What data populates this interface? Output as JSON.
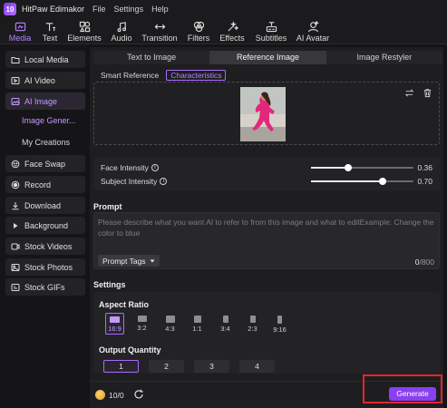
{
  "app": {
    "name": "HitPaw Edimakor",
    "logo_text": "10",
    "menu": [
      "File",
      "Settings",
      "Help"
    ]
  },
  "toolbar": {
    "items": [
      {
        "label": "Media",
        "icon": "media-icon",
        "active": true
      },
      {
        "label": "Text",
        "icon": "text-icon"
      },
      {
        "label": "Elements",
        "icon": "elements-icon"
      },
      {
        "label": "Audio",
        "icon": "audio-icon"
      },
      {
        "label": "Transition",
        "icon": "transition-icon"
      },
      {
        "label": "Filters",
        "icon": "filters-icon"
      },
      {
        "label": "Effects",
        "icon": "effects-icon"
      },
      {
        "label": "Subtitles",
        "icon": "subtitles-icon"
      },
      {
        "label": "AI Avatar",
        "icon": "ai-avatar-icon"
      }
    ]
  },
  "sidebar": {
    "items": [
      {
        "label": "Local Media",
        "icon": "folder-icon"
      },
      {
        "label": "AI Video",
        "icon": "ai-video-icon"
      },
      {
        "label": "AI Image",
        "icon": "ai-image-icon",
        "active": true
      },
      {
        "label": "Face Swap",
        "icon": "face-swap-icon"
      },
      {
        "label": "Record",
        "icon": "record-icon"
      },
      {
        "label": "Download",
        "icon": "download-icon"
      },
      {
        "label": "Background",
        "icon": "background-icon"
      },
      {
        "label": "Stock Videos",
        "icon": "stock-videos-icon"
      },
      {
        "label": "Stock Photos",
        "icon": "stock-photos-icon"
      },
      {
        "label": "Stock GIFs",
        "icon": "stock-gifs-icon"
      }
    ],
    "subitems": [
      {
        "label": "Image Gener...",
        "active": true
      },
      {
        "label": "My Creations"
      }
    ]
  },
  "main": {
    "tabs": [
      {
        "label": "Text to Image"
      },
      {
        "label": "Reference Image",
        "active": true
      },
      {
        "label": "Image Restyler"
      }
    ],
    "subtabs": [
      {
        "label": "Smart Reference"
      },
      {
        "label": "Characteristics",
        "active": true
      }
    ],
    "sliders": [
      {
        "label": "Face Intensity",
        "value": 0.36,
        "value_text": "0.36"
      },
      {
        "label": "Subject Intensity",
        "value": 0.7,
        "value_text": "0.70"
      }
    ],
    "prompt": {
      "title": "Prompt",
      "placeholder": "Please describe what you want AI to refer to from this image and what to editExample: Change the color to blue",
      "tags_label": "Prompt Tags",
      "count": "0",
      "max": "/800"
    },
    "settings": {
      "title": "Settings",
      "aspect_title": "Aspect Ratio",
      "ratios": [
        {
          "label": "16:9",
          "active": true
        },
        {
          "label": "3:2"
        },
        {
          "label": "4:3"
        },
        {
          "label": "1:1"
        },
        {
          "label": "3:4"
        },
        {
          "label": "2:3"
        },
        {
          "label": "9:16"
        }
      ],
      "quantity_title": "Output Quantity",
      "quantities": [
        {
          "label": "1",
          "active": true
        },
        {
          "label": "2"
        },
        {
          "label": "3"
        },
        {
          "label": "4"
        }
      ]
    },
    "footer": {
      "credits": "10/0",
      "generate_label": "Generate"
    }
  },
  "colors": {
    "accent": "#a86bff",
    "generate": "#8a3ff0",
    "highlight": "#e3262c"
  }
}
